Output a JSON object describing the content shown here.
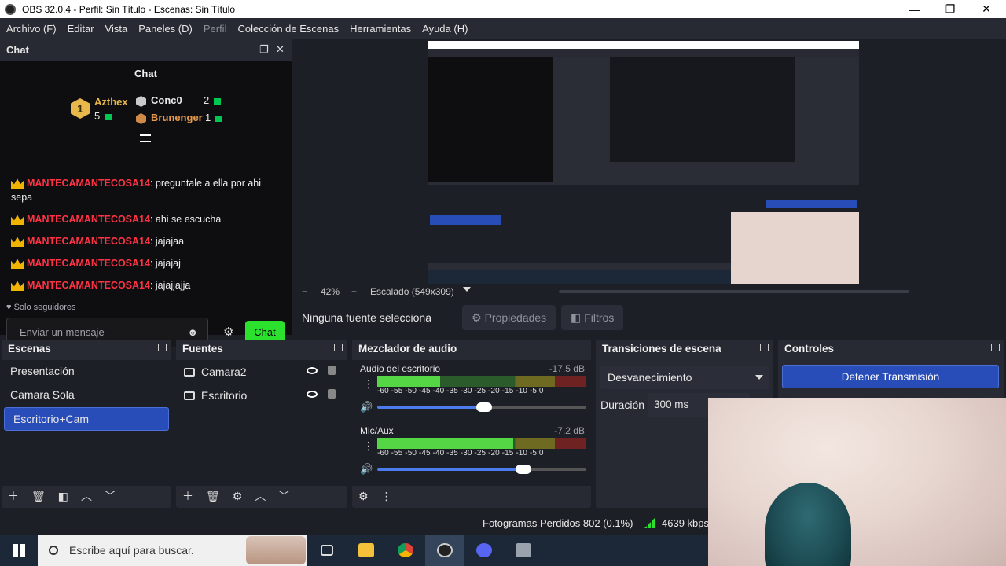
{
  "window": {
    "title": "OBS 32.0.4 - Perfil: Sin Título - Escenas: Sin Título",
    "minimize": "—",
    "maximize": "❐",
    "close": "✕"
  },
  "menu": [
    {
      "label": "Archivo (F)",
      "disabled": false
    },
    {
      "label": "Editar",
      "disabled": false
    },
    {
      "label": "Vista",
      "disabled": false
    },
    {
      "label": "Paneles (D)",
      "disabled": false
    },
    {
      "label": "Perfil",
      "disabled": true
    },
    {
      "label": "Colección de Escenas",
      "disabled": false
    },
    {
      "label": "Herramientas",
      "disabled": false
    },
    {
      "label": "Ayuda (H)",
      "disabled": false
    }
  ],
  "chat": {
    "dock_title": "Chat",
    "panel_title": "Chat",
    "leaderboard": {
      "first": {
        "rank": "1",
        "name": "Azthex",
        "score": "5"
      },
      "second": {
        "name": "Conc0",
        "score": "2"
      },
      "third": {
        "name": "Brunenger",
        "score": "1"
      }
    },
    "messages": [
      {
        "user": "MANTECAMANTECOSA14",
        "text": ": preguntale a ella por ahi sepa"
      },
      {
        "user": "MANTECAMANTECOSA14",
        "text": ": ahi se escucha"
      },
      {
        "user": "MANTECAMANTECOSA14",
        "text": ": jajajaa"
      },
      {
        "user": "MANTECAMANTECOSA14",
        "text": ": jajajaj"
      },
      {
        "user": "MANTECAMANTECOSA14",
        "text": ": jajajjajja"
      }
    ],
    "followers_only": "Solo seguidores",
    "input_placeholder": "Enviar un mensaje",
    "send_label": "Chat"
  },
  "preview": {
    "zoom": "42%",
    "scaled": "Escalado (549x309)",
    "minus": "−",
    "plus": "+"
  },
  "source_toolbar": {
    "no_source": "Ninguna fuente seleccionada",
    "properties": "Propiedades",
    "filters": "Filtros"
  },
  "scenes": {
    "title": "Escenas",
    "items": [
      "Presentación",
      "Camara Sola",
      "Escritorio+Cam"
    ],
    "selected": 2
  },
  "sources": {
    "title": "Fuentes",
    "items": [
      "Camara2",
      "Escritorio"
    ]
  },
  "mixer": {
    "title": "Mezclador de audio",
    "scale": "-60  -55  -50  -45  -40  -35  -30  -25  -20  -15  -10  -5   0",
    "channels": [
      {
        "name": "Audio del escritorio",
        "db": "-17.5 dB",
        "level_pct": 30,
        "volume_pct": 51
      },
      {
        "name": "Mic/Aux",
        "db": "-7.2 dB",
        "level_pct": 65,
        "volume_pct": 70
      }
    ]
  },
  "transitions": {
    "title": "Transiciones de escena",
    "selected": "Desvanecimiento",
    "duration_label": "Duración",
    "duration_value": "300 ms"
  },
  "controls": {
    "title": "Controles",
    "stop_stream": "Detener Transmisión"
  },
  "status": {
    "frames_dropped": "Fotogramas Perdidos 802 (0.1%)",
    "bitrate": "4639 kbps"
  },
  "taskbar": {
    "search_placeholder": "Escribe aquí para buscar."
  }
}
